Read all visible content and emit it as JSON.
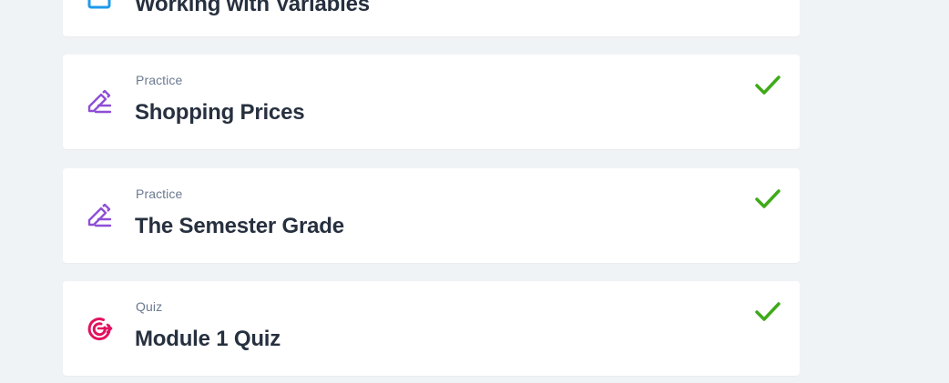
{
  "lessons": [
    {
      "type": "",
      "title": "Working with Variables",
      "icon": "lesson-icon",
      "completed": false
    },
    {
      "type": "Practice",
      "title": "Shopping Prices",
      "icon": "pencil-icon",
      "completed": true
    },
    {
      "type": "Practice",
      "title": "The Semester Grade",
      "icon": "pencil-icon",
      "completed": true
    },
    {
      "type": "Quiz",
      "title": "Module 1 Quiz",
      "icon": "target-icon",
      "completed": true
    }
  ],
  "colors": {
    "page_background": "#f0f3f6",
    "card_background": "#ffffff",
    "practice_icon": "#8e4fd6",
    "quiz_icon": "#e2125f",
    "lesson_icon": "#1e9be9",
    "check": "#3faa19",
    "title_text": "#27303f",
    "type_text": "#6b7a90"
  }
}
